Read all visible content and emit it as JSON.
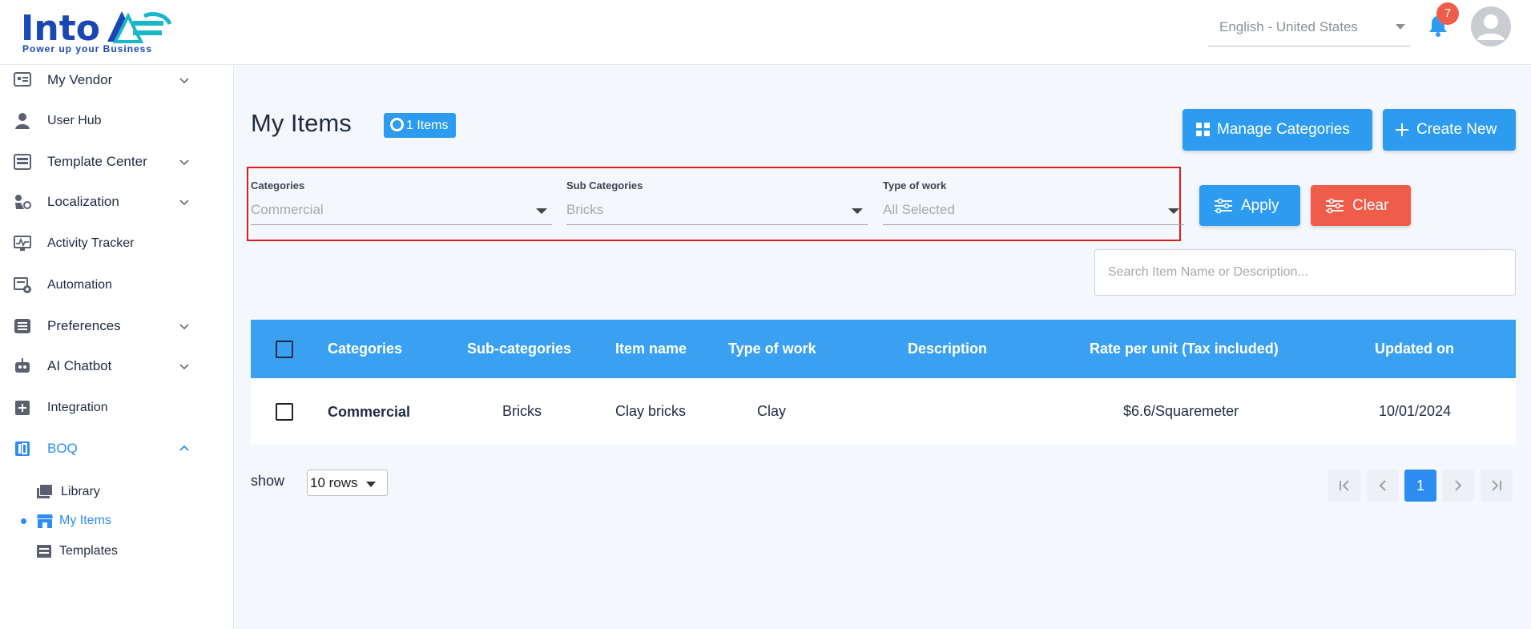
{
  "header": {
    "logo_text": "IntoAEC",
    "logo_tagline": "Power up your Business",
    "language": "English - United States",
    "notification_count": "7"
  },
  "sidebar": {
    "items": [
      {
        "label": "My Vendor",
        "icon": "vendor-icon",
        "expandable": true
      },
      {
        "label": "User Hub",
        "icon": "user-icon",
        "expandable": false
      },
      {
        "label": "Template Center",
        "icon": "template-icon",
        "expandable": true
      },
      {
        "label": "Localization",
        "icon": "localization-icon",
        "expandable": true
      },
      {
        "label": "Activity Tracker",
        "icon": "activity-icon",
        "expandable": false
      },
      {
        "label": "Automation",
        "icon": "automation-icon",
        "expandable": false
      },
      {
        "label": "Preferences",
        "icon": "preferences-icon",
        "expandable": true
      },
      {
        "label": "AI Chatbot",
        "icon": "chatbot-icon",
        "expandable": true
      },
      {
        "label": "Integration",
        "icon": "integration-icon",
        "expandable": false
      },
      {
        "label": "BOQ",
        "icon": "boq-icon",
        "expandable": true,
        "expanded": true
      }
    ],
    "boq_sub_items": [
      {
        "label": "Library",
        "icon": "library-icon"
      },
      {
        "label": "My Items",
        "icon": "store-icon",
        "active": true
      },
      {
        "label": "Templates",
        "icon": "templates-icon"
      }
    ]
  },
  "main": {
    "title": "My Items",
    "count_badge": "1 Items",
    "manage_categories_label": "Manage Categories",
    "create_new_label": "Create New",
    "apply_label": "Apply",
    "clear_label": "Clear",
    "filters": {
      "categories": {
        "label": "Categories",
        "value": "Commercial"
      },
      "sub_categories": {
        "label": "Sub Categories",
        "value": "Bricks"
      },
      "type_of_work": {
        "label": "Type of work",
        "value": "All Selected"
      }
    },
    "search_placeholder": "Search Item Name or Description...",
    "table": {
      "columns": [
        "Categories",
        "Sub-categories",
        "Item name",
        "Type of work",
        "Description",
        "Rate per unit (Tax included)",
        "Updated on"
      ],
      "rows": [
        {
          "category": "Commercial",
          "sub_category": "Bricks",
          "item_name": "Clay bricks",
          "type_of_work": "Clay",
          "description": "",
          "rate": "$6.6/Squaremeter",
          "updated_on": "10/01/2024"
        }
      ]
    },
    "pagination": {
      "show_label": "show",
      "rows_value": "10 rows",
      "current_page": "1"
    }
  },
  "colors": {
    "primary": "#2d9cf0",
    "danger": "#f05c4a",
    "brand": "#1a47b3",
    "highlight_border": "#e21b1b"
  }
}
